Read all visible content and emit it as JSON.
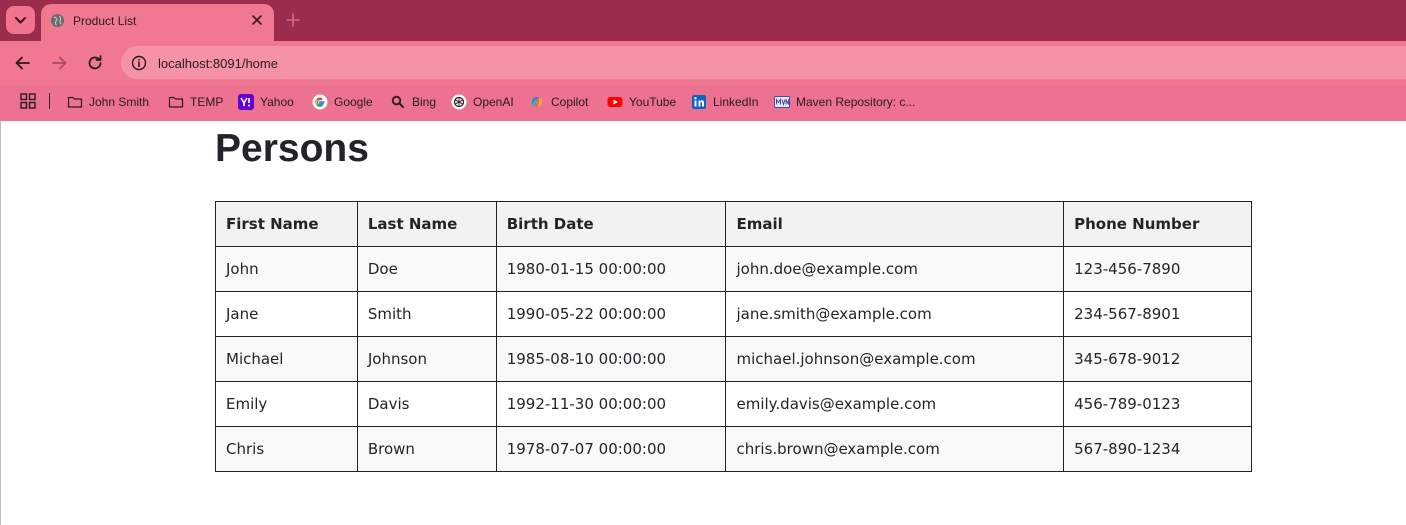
{
  "browser": {
    "tab": {
      "title": "Product List",
      "favicon": "globe-icon",
      "close": "close-icon"
    },
    "newtab_icon": "plus-icon",
    "nav": {
      "back": "arrow-left-icon",
      "forward": "arrow-right-icon",
      "reload": "reload-icon"
    },
    "address": {
      "url": "localhost:8091/home",
      "info_icon": "info-icon"
    },
    "bookmarks": [
      {
        "label": "John Smith",
        "icon": "folder-icon"
      },
      {
        "label": "TEMP",
        "icon": "folder-icon"
      },
      {
        "label": "Yahoo",
        "icon": "yahoo-icon"
      },
      {
        "label": "Google",
        "icon": "google-icon"
      },
      {
        "label": "Bing",
        "icon": "search-icon"
      },
      {
        "label": "OpenAI",
        "icon": "openai-icon"
      },
      {
        "label": "Copilot",
        "icon": "copilot-icon"
      },
      {
        "label": "YouTube",
        "icon": "youtube-icon"
      },
      {
        "label": "LinkedIn",
        "icon": "linkedin-icon"
      },
      {
        "label": "Maven Repository: c...",
        "icon": "maven-icon"
      }
    ],
    "colors": {
      "tabstrip": "#9c2c4b",
      "toolbar": "#f07890",
      "bookmarks": "#ed7190"
    }
  },
  "page": {
    "title": "Persons",
    "table": {
      "headers": [
        "First Name",
        "Last Name",
        "Birth Date",
        "Email",
        "Phone Number"
      ],
      "rows": [
        [
          "John",
          "Doe",
          "1980-01-15 00:00:00",
          "john.doe@example.com",
          "123-456-7890"
        ],
        [
          "Jane",
          "Smith",
          "1990-05-22 00:00:00",
          "jane.smith@example.com",
          "234-567-8901"
        ],
        [
          "Michael",
          "Johnson",
          "1985-08-10 00:00:00",
          "michael.johnson@example.com",
          "345-678-9012"
        ],
        [
          "Emily",
          "Davis",
          "1992-11-30 00:00:00",
          "emily.davis@example.com",
          "456-789-0123"
        ],
        [
          "Chris",
          "Brown",
          "1978-07-07 00:00:00",
          "chris.brown@example.com",
          "567-890-1234"
        ]
      ]
    }
  }
}
